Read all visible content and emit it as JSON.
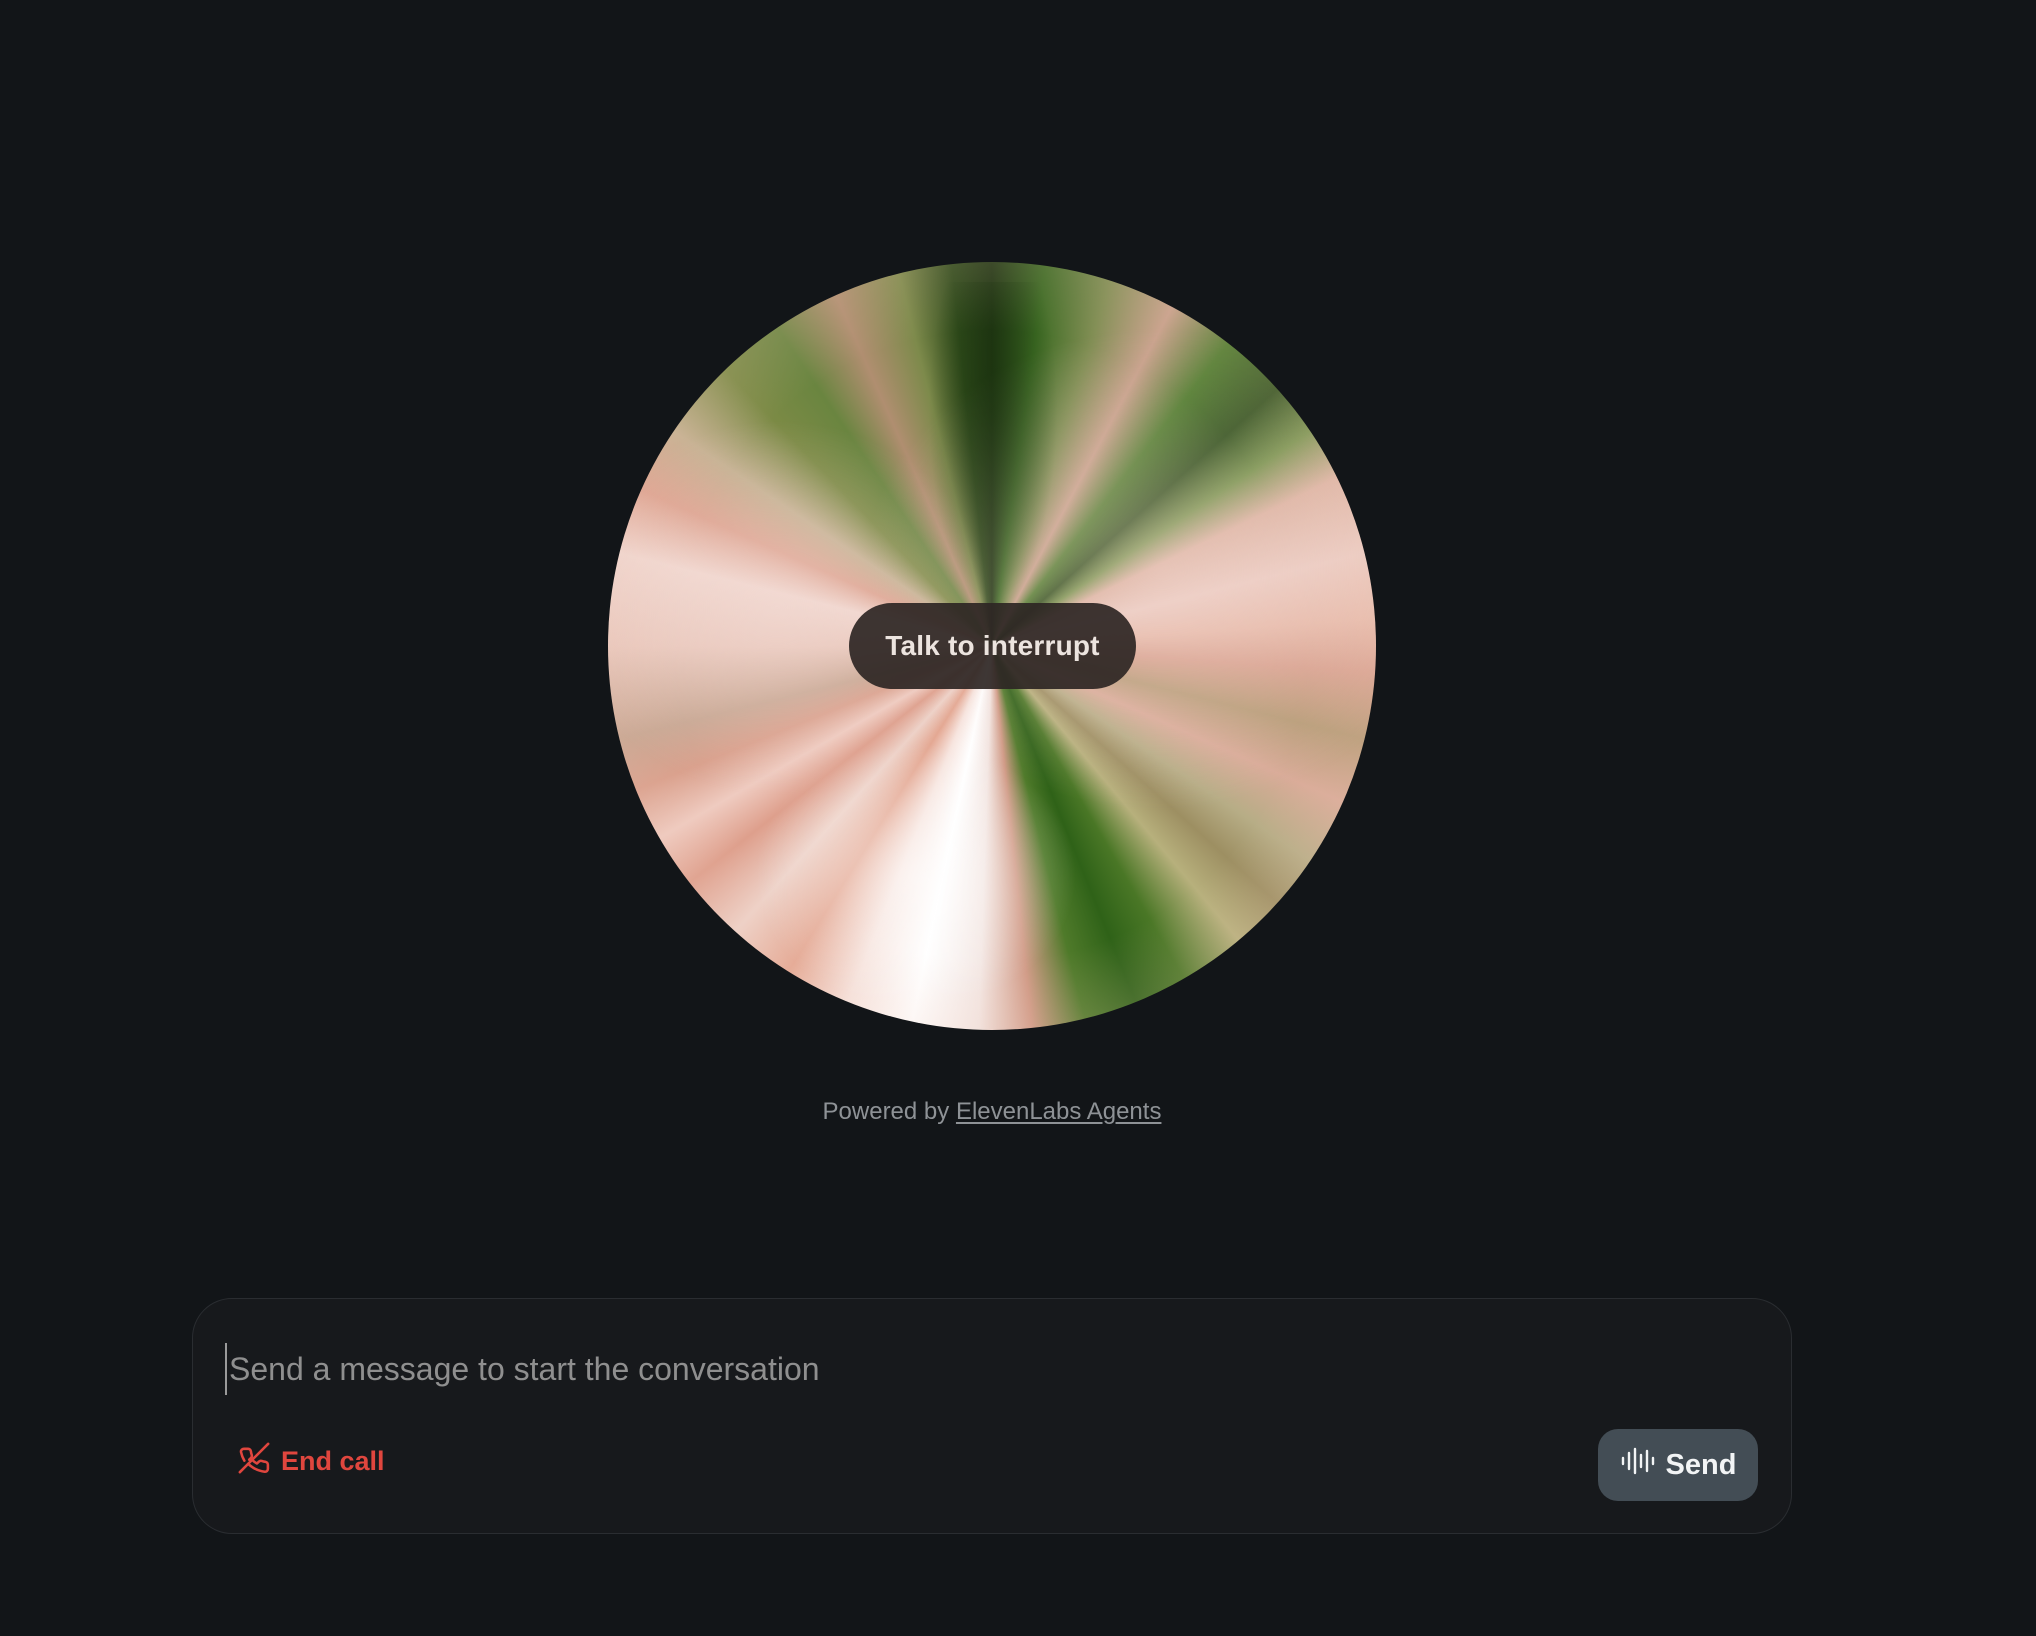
{
  "orb": {
    "interrupt_label": "Talk to interrupt"
  },
  "footer": {
    "powered_prefix": "Powered by",
    "powered_link": "ElevenLabs Agents"
  },
  "composer": {
    "placeholder": "Send a message to start the conversation",
    "end_call_label": "End call",
    "send_label": "Send"
  },
  "icons": {
    "end_call": "phone-off-icon",
    "send": "waveform-icon"
  },
  "colors": {
    "background": "#121518",
    "end_call": "#e0463e",
    "send_button": "#434d55"
  }
}
